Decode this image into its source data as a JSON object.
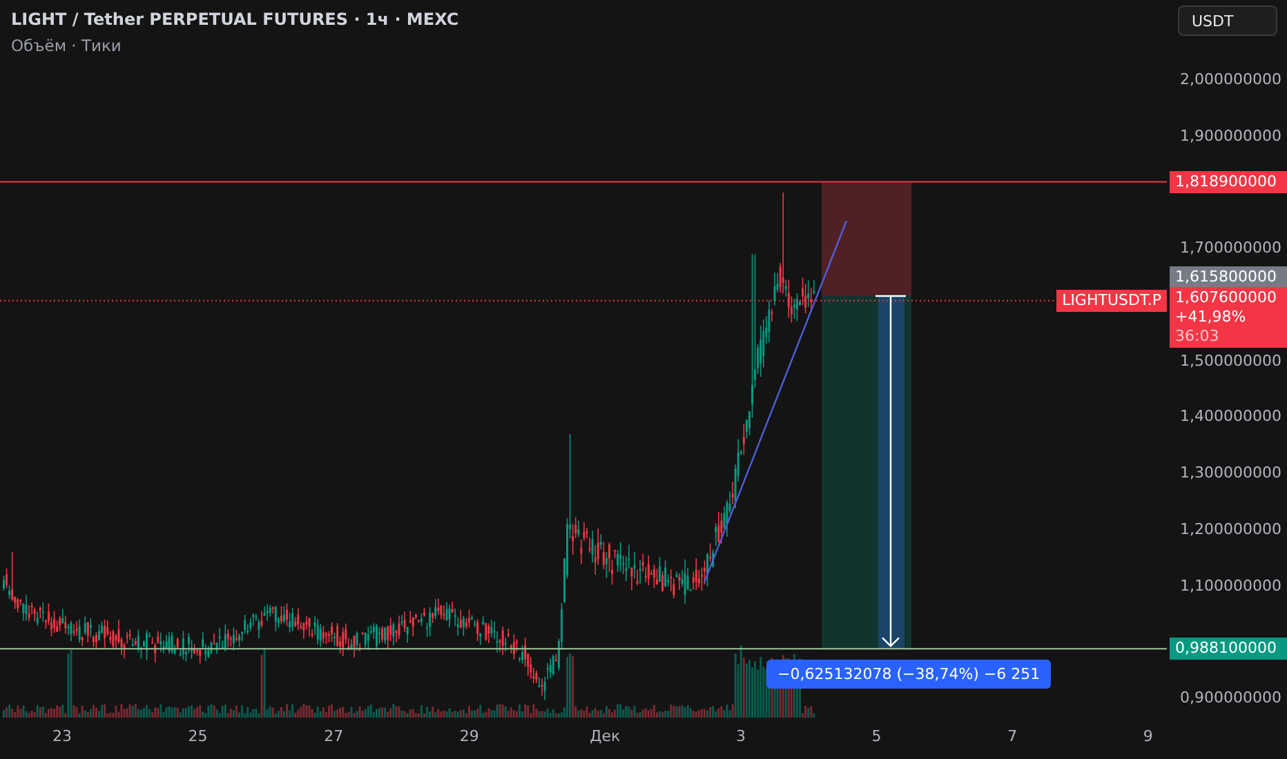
{
  "legend": {
    "title": "LIGHT / Tether PERPETUAL FUTURES · 1ч · MEXC",
    "indicator": "Объём · Тики"
  },
  "currency_button": "USDT",
  "price_ticks": [
    "2,000000000",
    "1,900000000",
    "1,700000000",
    "1,500000000",
    "1,400000000",
    "1,300000000",
    "1,200000000",
    "1,100000000",
    "0,900000000"
  ],
  "price_labels": [
    {
      "text": "1,818900000",
      "kind": "high"
    },
    {
      "text": "1,615800000",
      "kind": "marker"
    },
    {
      "text": "1,607600000",
      "kind": "last",
      "change": "+41,98%",
      "countdown": "36:03"
    },
    {
      "text": "0,988100000",
      "kind": "low"
    }
  ],
  "symbol_tag": "LIGHTUSDT.P",
  "measure_label": "−0,625132078 (−38,74%) −6 251",
  "time_ticks": [
    "23",
    "25",
    "27",
    "29",
    "Дек",
    "3",
    "5",
    "7",
    "9"
  ]
}
